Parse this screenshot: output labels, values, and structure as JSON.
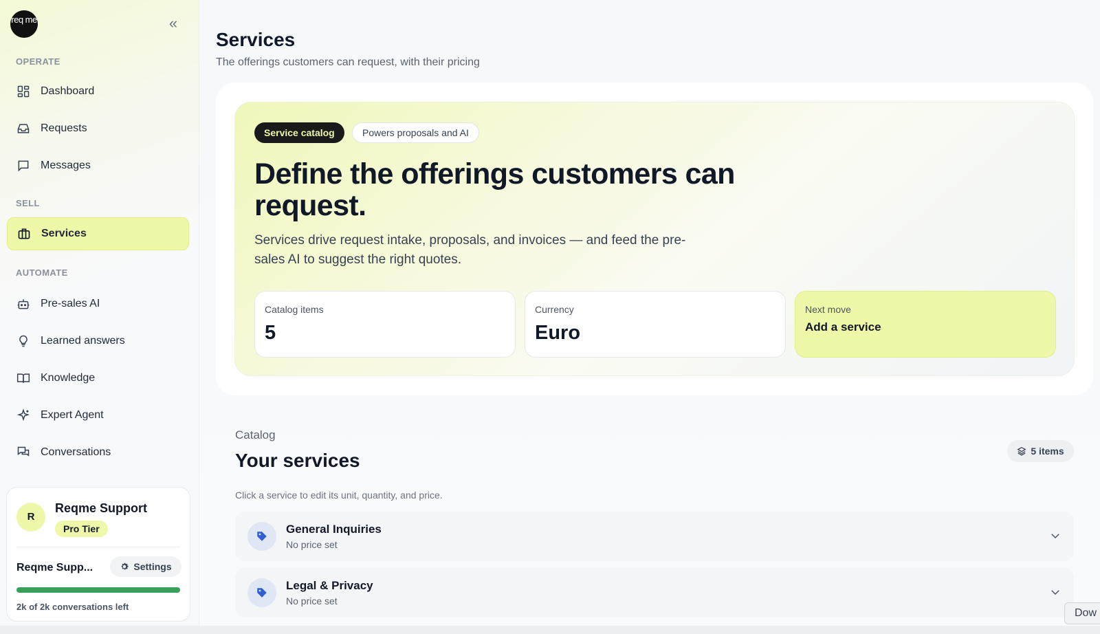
{
  "sidebar": {
    "logo_text": "req me",
    "sections": {
      "operate": "OPERATE",
      "sell": "SELL",
      "automate": "AUTOMATE"
    },
    "items": [
      {
        "label": "Dashboard",
        "icon": "grid-icon"
      },
      {
        "label": "Requests",
        "icon": "inbox-icon"
      },
      {
        "label": "Messages",
        "icon": "message-square-icon"
      },
      {
        "label": "Services",
        "icon": "briefcase-icon",
        "active": true
      },
      {
        "label": "Pre-sales AI",
        "icon": "bot-icon"
      },
      {
        "label": "Learned answers",
        "icon": "lightbulb-icon"
      },
      {
        "label": "Knowledge",
        "icon": "book-open-icon"
      },
      {
        "label": "Expert Agent",
        "icon": "sparkles-icon"
      },
      {
        "label": "Conversations",
        "icon": "messages-icon"
      }
    ],
    "account": {
      "avatar_initial": "R",
      "name": "Reqme Support",
      "tier": "Pro Tier",
      "short_name": "Reqme Supp...",
      "settings_label": "Settings",
      "usage_fraction": 1.0,
      "usage_text": "2k of 2k conversations left"
    }
  },
  "header": {
    "title": "Services",
    "subtitle": "The offerings customers can request, with their pricing"
  },
  "hero": {
    "pill_primary": "Service catalog",
    "pill_secondary": "Powers proposals and AI",
    "heading": "Define the offerings customers can request.",
    "description": "Services drive request intake, proposals, and invoices — and feed the pre-sales AI to suggest the right quotes.",
    "stats": [
      {
        "label": "Catalog items",
        "value": "5"
      },
      {
        "label": "Currency",
        "value": "Euro"
      },
      {
        "label": "Next move",
        "value": "Add a service"
      }
    ]
  },
  "catalog": {
    "label": "Catalog",
    "title": "Your services",
    "count_badge": "5 items",
    "hint": "Click a service to edit its unit, quantity, and price.",
    "services": [
      {
        "name": "General Inquiries",
        "price": "No price set"
      },
      {
        "name": "Legal & Privacy",
        "price": "No price set"
      }
    ]
  },
  "tooltip": {
    "text": "Dow"
  },
  "colors": {
    "accent": "#eef8a8",
    "dark_pill": "#1a1a1a",
    "progress": "#3a9e5c",
    "tag_icon": "#2f5fd0"
  }
}
